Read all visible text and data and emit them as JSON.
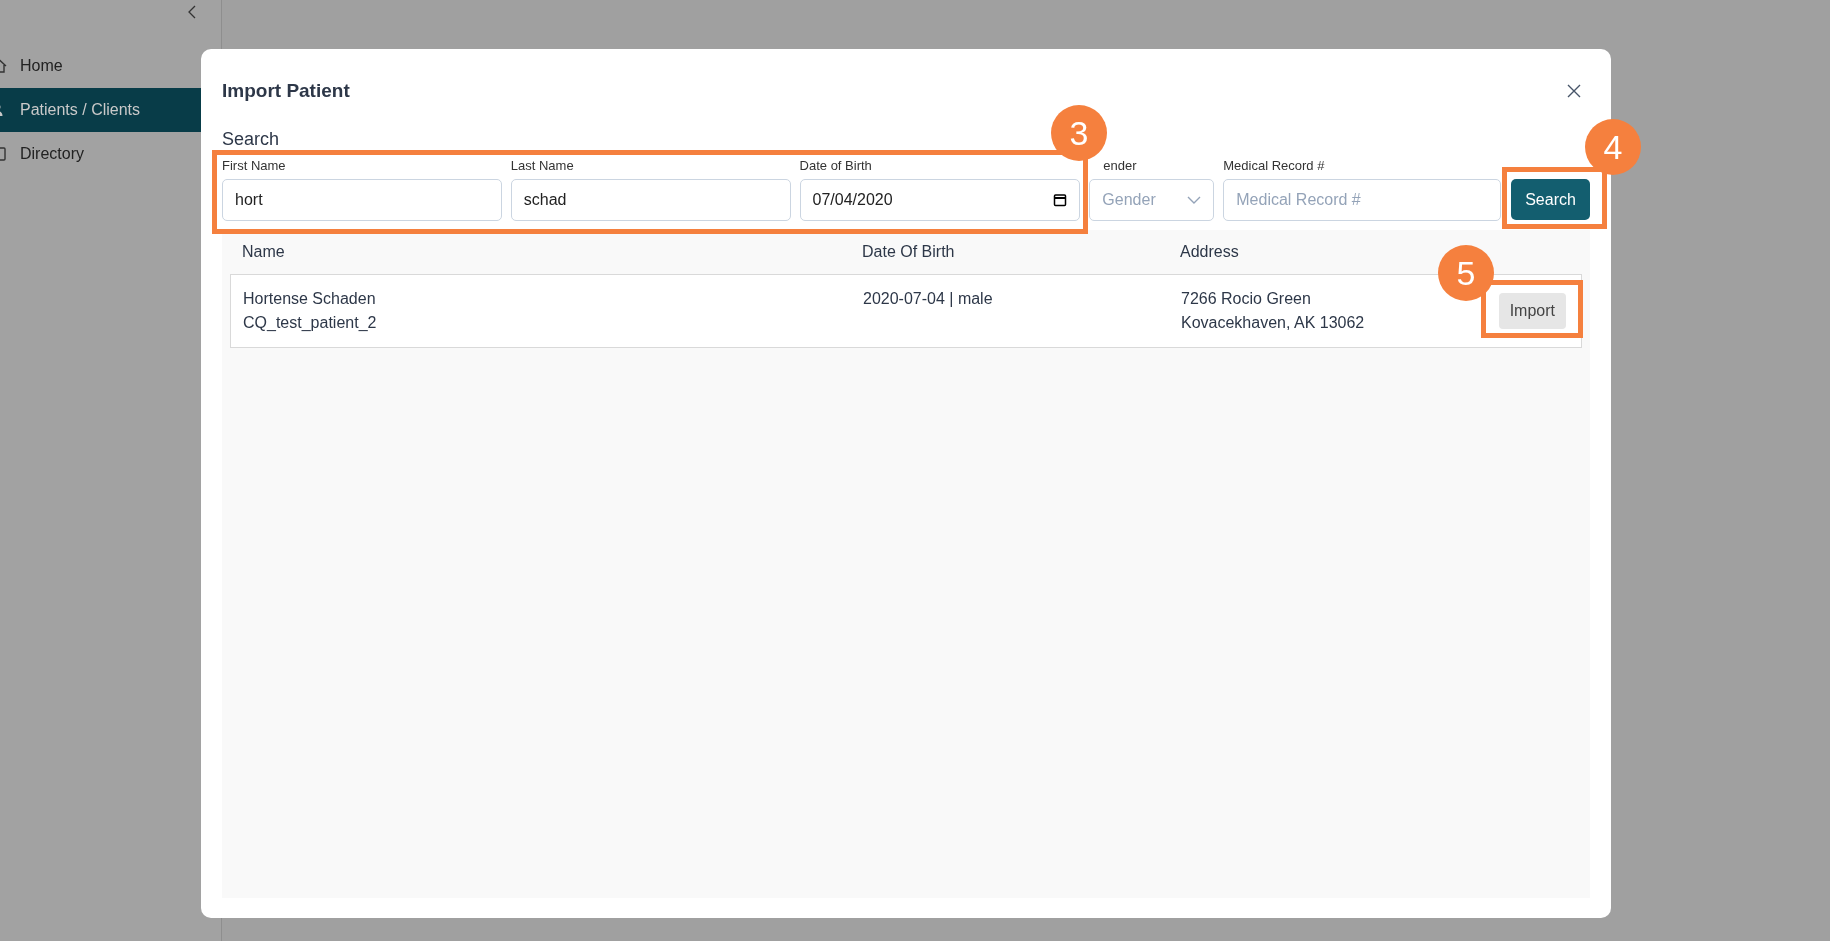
{
  "sidebar": {
    "items": [
      {
        "label": "Home",
        "selected": false
      },
      {
        "label": "Patients / Clients",
        "selected": true
      },
      {
        "label": "Directory",
        "selected": false
      }
    ]
  },
  "dialog": {
    "title": "Import Patient",
    "section": "Search",
    "fields": [
      {
        "kind": "text",
        "label": "First Name",
        "value": "hort"
      },
      {
        "kind": "text",
        "label": "Last Name",
        "value": "schad"
      },
      {
        "kind": "date",
        "label": "Date of Birth",
        "value": "07/04/2020"
      },
      {
        "kind": "select",
        "label": "ender",
        "placeholder": "Gender"
      },
      {
        "kind": "text",
        "label": "Medical Record #",
        "placeholder": "Medical Record #"
      }
    ],
    "search_button": "Search",
    "table": {
      "columns": [
        "Name",
        "Date Of Birth",
        "Address"
      ],
      "rows": [
        {
          "name": "Hortense Schaden",
          "id": "CQ_test_patient_2",
          "birth": "2020-07-04 | male",
          "address": [
            "7266 Rocio Green",
            "Kovacekhaven, AK 13062"
          ],
          "action": "Import"
        }
      ]
    }
  },
  "annotations": [
    {
      "number": "3"
    },
    {
      "number": "4"
    },
    {
      "number": "5"
    }
  ]
}
